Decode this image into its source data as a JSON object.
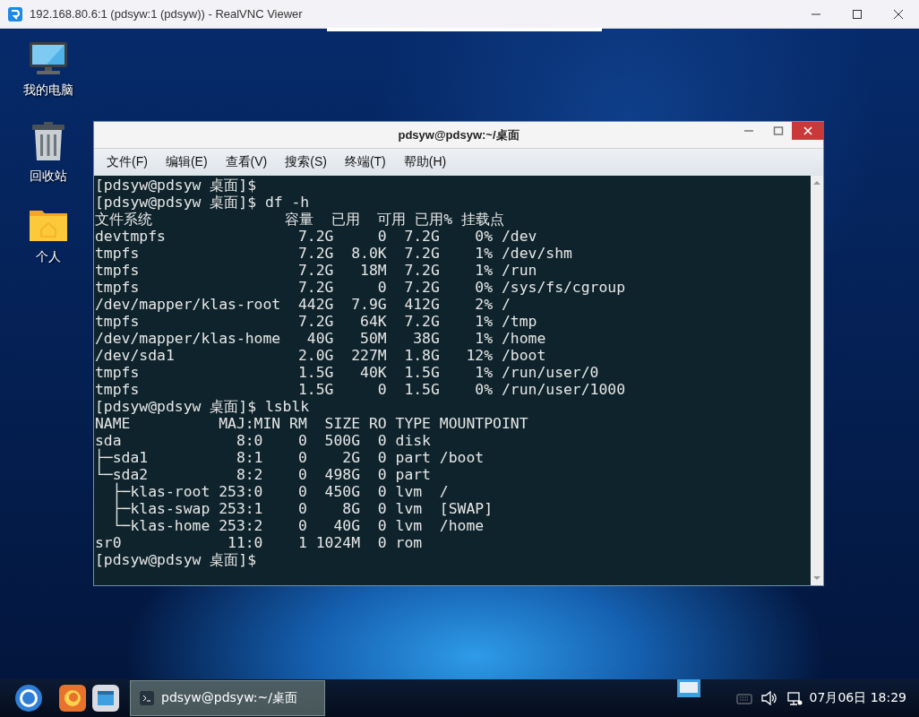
{
  "vnc_window": {
    "title": "192.168.80.6:1 (pdsyw:1 (pdsyw)) - RealVNC Viewer"
  },
  "desktop_icons": [
    {
      "label": "我的电脑",
      "kind": "computer"
    },
    {
      "label": "回收站",
      "kind": "trash"
    },
    {
      "label": "个人",
      "kind": "home"
    }
  ],
  "terminal": {
    "title": "pdsyw@pdsyw:~/桌面",
    "menu": [
      "文件(F)",
      "编辑(E)",
      "查看(V)",
      "搜索(S)",
      "终端(T)",
      "帮助(H)"
    ],
    "lines": [
      "[pdsyw@pdsyw 桌面]$",
      "[pdsyw@pdsyw 桌面]$ df -h",
      "文件系统               容量  已用  可用 已用% 挂载点",
      "devtmpfs               7.2G     0  7.2G    0% /dev",
      "tmpfs                  7.2G  8.0K  7.2G    1% /dev/shm",
      "tmpfs                  7.2G   18M  7.2G    1% /run",
      "tmpfs                  7.2G     0  7.2G    0% /sys/fs/cgroup",
      "/dev/mapper/klas-root  442G  7.9G  412G    2% /",
      "tmpfs                  7.2G   64K  7.2G    1% /tmp",
      "/dev/mapper/klas-home   40G   50M   38G    1% /home",
      "/dev/sda1              2.0G  227M  1.8G   12% /boot",
      "tmpfs                  1.5G   40K  1.5G    1% /run/user/0",
      "tmpfs                  1.5G     0  1.5G    0% /run/user/1000",
      "[pdsyw@pdsyw 桌面]$ lsblk",
      "NAME          MAJ:MIN RM  SIZE RO TYPE MOUNTPOINT",
      "sda             8:0    0  500G  0 disk",
      "├─sda1          8:1    0    2G  0 part /boot",
      "└─sda2          8:2    0  498G  0 part",
      "  ├─klas-root 253:0    0  450G  0 lvm  /",
      "  ├─klas-swap 253:1    0    8G  0 lvm  [SWAP]",
      "  └─klas-home 253:2    0   40G  0 lvm  /home",
      "sr0            11:0    1 1024M  0 rom",
      "[pdsyw@pdsyw 桌面]$"
    ]
  },
  "taskbar": {
    "tasks": [
      {
        "label": "pdsyw@pdsyw:~/桌面",
        "selected": true
      }
    ],
    "clock": "07月06日 18:29"
  }
}
